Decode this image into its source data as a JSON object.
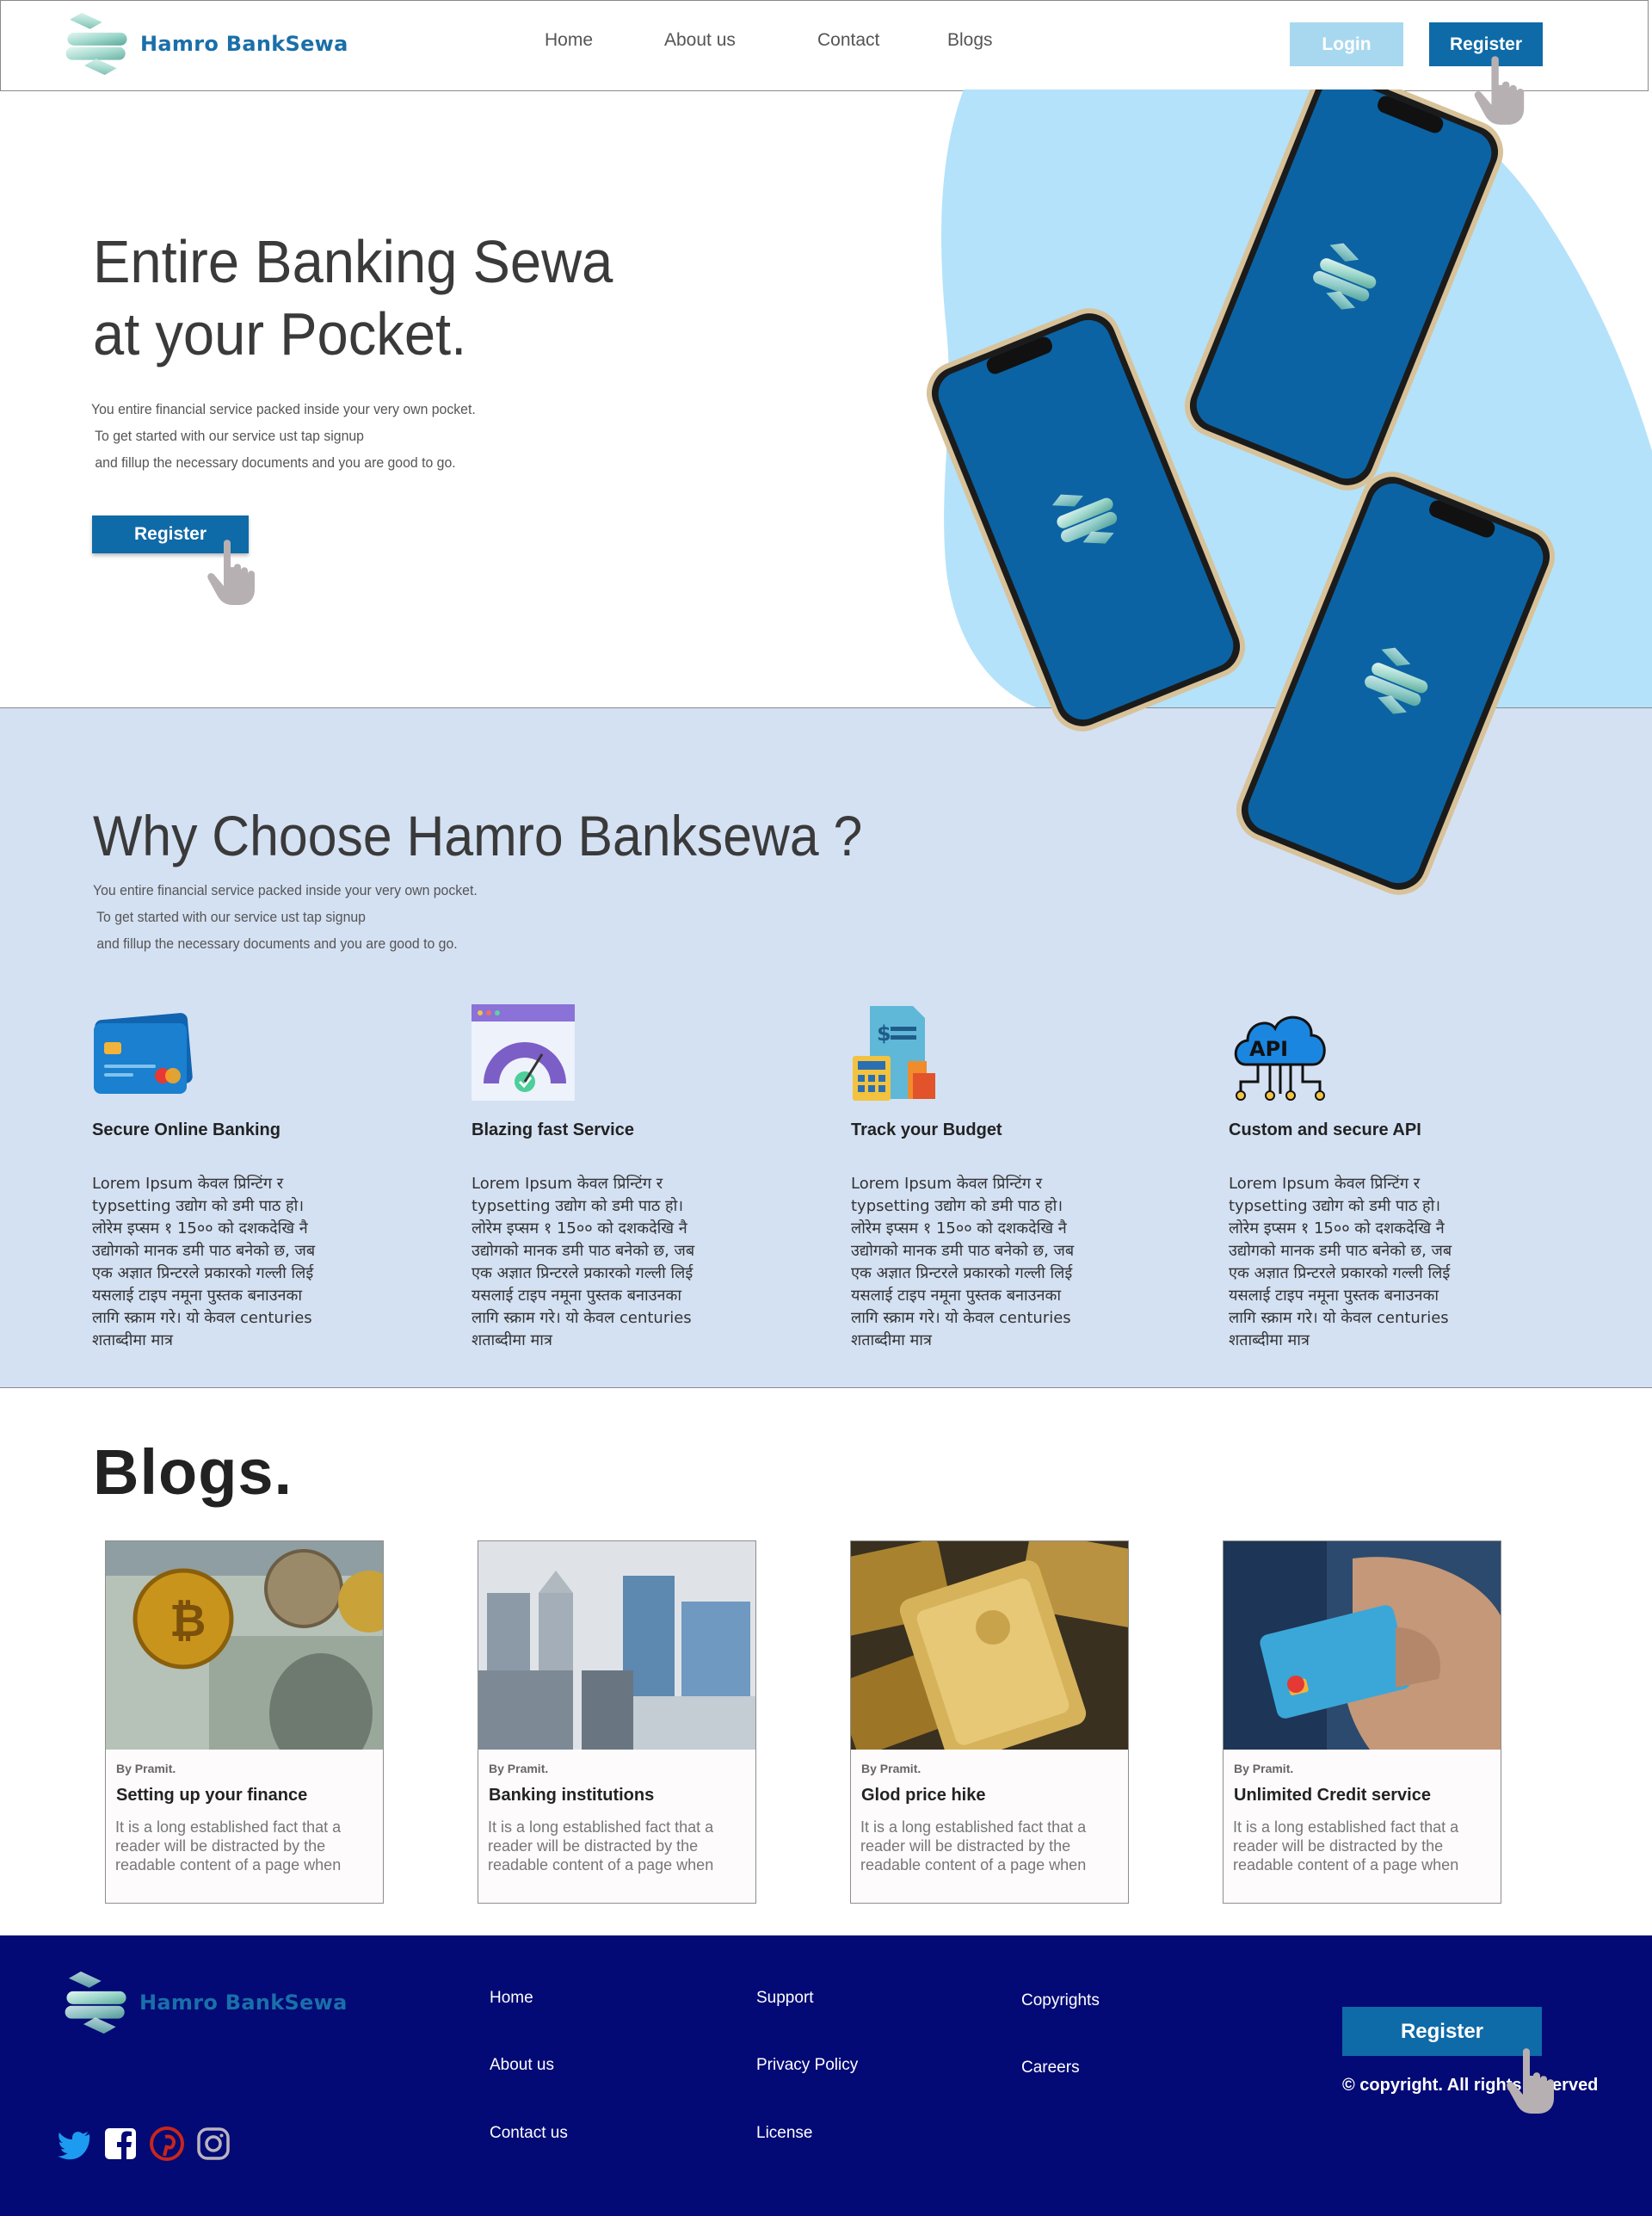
{
  "brand": {
    "name": "Hamro BankSewa"
  },
  "nav": {
    "home": "Home",
    "about": "About us",
    "contact": "Contact",
    "blogs": "Blogs"
  },
  "auth": {
    "login_label": "Login",
    "register_label": "Register"
  },
  "hero": {
    "title_line1": "Entire Banking Sewa",
    "title_line2": "at your Pocket.",
    "desc_line1": "You entire financial service packed inside your very own pocket.",
    "desc_line2": " To get started with our service ust tap signup",
    "desc_line3": " and fillup the necessary documents and you are good to go.",
    "register_label": "Register"
  },
  "why": {
    "title": "Why Choose Hamro Banksewa ?",
    "desc_line1": "You entire financial service packed inside your very own pocket.",
    "desc_line2": " To get started with our service ust tap signup",
    "desc_line3": " and fillup the necessary documents and you are good to go.",
    "features": [
      {
        "icon": "credit-card-icon",
        "title": "Secure Online Banking",
        "body": "Lorem Ipsum केवल प्रिन्टिंग र typsetting उद्योग को डमी पाठ हो। लोरेम इप्सम १ 15०० को दशकदेखि नै उद्योगको मानक डमी पाठ बनेको छ, जब एक अज्ञात प्रिन्टरले प्रकारको गल्ली लिई यसलाई टाइप नमूना पुस्तक बनाउनका लागि स्क्राम गरे। यो केवल centuries शताब्दीमा मात्र"
      },
      {
        "icon": "speedometer-icon",
        "title": "Blazing fast Service",
        "body": "Lorem Ipsum केवल प्रिन्टिंग र typsetting उद्योग को डमी पाठ हो। लोरेम इप्सम १ 15०० को दशकदेखि नै उद्योगको मानक डमी पाठ बनेको छ, जब एक अज्ञात प्रिन्टरले प्रकारको गल्ली लिई यसलाई टाइप नमूना पुस्तक बनाउनका लागि स्क्राम गरे। यो केवल centuries शताब्दीमा मात्र"
      },
      {
        "icon": "budget-calculator-icon",
        "title": "Track your Budget",
        "body": "Lorem Ipsum केवल प्रिन्टिंग र typsetting उद्योग को डमी पाठ हो। लोरेम इप्सम १ 15०० को दशकदेखि नै उद्योगको मानक डमी पाठ बनेको छ, जब एक अज्ञात प्रिन्टरले प्रकारको गल्ली लिई यसलाई टाइप नमूना पुस्तक बनाउनका लागि स्क्राम गरे। यो केवल centuries शताब्दीमा मात्र"
      },
      {
        "icon": "api-cloud-icon",
        "icon_text": "API",
        "title": "Custom and secure API",
        "body": "Lorem Ipsum केवल प्रिन्टिंग र typsetting उद्योग को डमी पाठ हो। लोरेम इप्सम १ 15०० को दशकदेखि नै उद्योगको मानक डमी पाठ बनेको छ, जब एक अज्ञात प्रिन्टरले प्रकारको गल्ली लिई यसलाई टाइप नमूना पुस्तक बनाउनका लागि स्क्राम गरे। यो केवल centuries शताब्दीमा मात्र"
      }
    ]
  },
  "blogs": {
    "title": "Blogs.",
    "items": [
      {
        "image": "bitcoin-dollar-image",
        "author": "By Pramit.",
        "title": "Setting up your finance",
        "excerpt": "It is a long established fact that a reader will be distracted by the readable content of a page when"
      },
      {
        "image": "city-buildings-image",
        "author": "By Pramit.",
        "title": "Banking institutions",
        "excerpt": "It is a long established fact that a reader will be distracted by the readable content of a page when"
      },
      {
        "image": "gold-bars-image",
        "author": "By Pramit.",
        "title": "Glod price hike",
        "excerpt": "It is a long established fact that a reader will be distracted by the readable content of a page when"
      },
      {
        "image": "credit-card-hand-image",
        "author": "By Pramit.",
        "title": "Unlimited Credit service",
        "excerpt": "It is a long established fact that a reader will be distracted by the readable content of a page when"
      }
    ]
  },
  "footer": {
    "links": {
      "home": "Home",
      "about": "About us",
      "contact": "Contact us",
      "support": "Support",
      "privacy": "Privacy Policy",
      "license": "License",
      "copyrights": "Copyrights",
      "careers": "Careers"
    },
    "register_label": "Register",
    "copyright": "© copyright. All rights reserved",
    "social": [
      "twitter-icon",
      "facebook-icon",
      "pinterest-icon",
      "instagram-icon"
    ]
  },
  "colors": {
    "primary": "#0f6aa8",
    "login": "#a8d8ef",
    "features_bg": "#d4e1f3",
    "footer_bg": "#030a75",
    "hero_blob": "#b4e2fa"
  }
}
